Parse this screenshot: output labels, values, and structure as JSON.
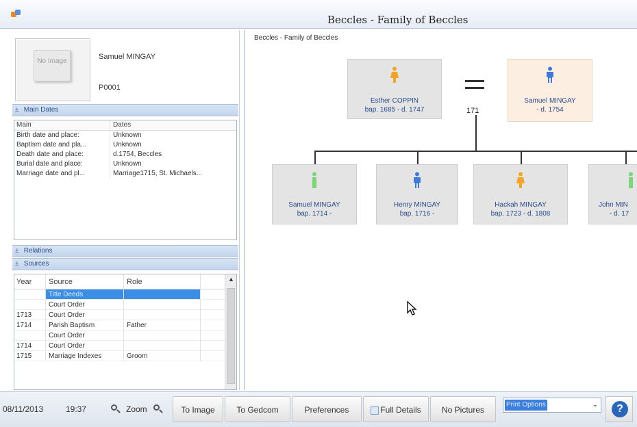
{
  "window": {
    "title": "Beccles - Family of Beccles"
  },
  "person": {
    "photo_text": "No Image",
    "name": "Samuel MINGAY",
    "id": "P0001"
  },
  "main_dates": {
    "header": "Main Dates",
    "expander": "±",
    "columns": [
      "Main",
      "Dates"
    ],
    "rows": [
      {
        "main": "Birth date and place:",
        "dates": "Unknown"
      },
      {
        "main": "Baptism date and pla...",
        "dates": "Unknown"
      },
      {
        "main": "Death date and place:",
        "dates": "d.1754, Beccles"
      },
      {
        "main": "Burial date and place:",
        "dates": "Unknown"
      },
      {
        "main": "Marriage date and pl...",
        "dates": "Marriage1715, St. Michaels..."
      }
    ]
  },
  "relations": {
    "header": "Relations",
    "expander": "±"
  },
  "sources": {
    "header": "Sources",
    "expander": "±",
    "columns": [
      "Year",
      "Source",
      "Role"
    ],
    "rows": [
      {
        "year": "",
        "source": "Title Deeds",
        "role": "",
        "selected": true
      },
      {
        "year": "",
        "source": "Court Order",
        "role": ""
      },
      {
        "year": "1713",
        "source": "Court Order",
        "role": ""
      },
      {
        "year": "1714",
        "source": "Parish Baptism",
        "role": "Father"
      },
      {
        "year": "",
        "source": "Court Order",
        "role": ""
      },
      {
        "year": "1714",
        "source": "Court Order",
        "role": ""
      },
      {
        "year": "1715",
        "source": "Marriage Indexes",
        "role": "Groom"
      }
    ]
  },
  "tree": {
    "caption": "Beccles - Family of Beccles",
    "marriage_year": "171",
    "parents": [
      {
        "name": "Esther COPPIN",
        "dates": "bap. 1685 - d. 1747",
        "gender": "female",
        "color": "#f2a623"
      },
      {
        "name": "Samuel MINGAY",
        "dates": "- d. 1754",
        "gender": "male",
        "color": "#3f7ad8"
      }
    ],
    "children": [
      {
        "name": "Samuel MINGAY",
        "dates": "bap. 1714 -",
        "gender": "unknown",
        "color": "#7fd47a"
      },
      {
        "name": "Henry MINGAY",
        "dates": "bap. 1716 -",
        "gender": "male",
        "color": "#3f7ad8"
      },
      {
        "name": "Hackah MINGAY",
        "dates": "bap. 1723 - d. 1808",
        "gender": "female",
        "color": "#f2a623"
      },
      {
        "name": "John MIN",
        "dates": "- d. 17",
        "gender": "unknown",
        "color": "#7fd47a"
      }
    ]
  },
  "toolbar": {
    "date": "08/11/2013",
    "time": "19:37",
    "zoom_label": "Zoom",
    "to_image": "To Image",
    "to_gedcom": "To Gedcom",
    "preferences": "Preferences",
    "full_details": "Full Details",
    "no_pictures": "No Pictures",
    "print_options": "Print Options",
    "help": "?"
  },
  "icons": [
    "app-icon",
    "zoom-out-icon",
    "zoom-in-icon",
    "female-figure-icon",
    "male-figure-icon",
    "unknown-figure-icon",
    "help-icon",
    "dropdown-arrow-icon",
    "scroll-up-icon",
    "mouse-cursor-icon",
    "checkbox-icon"
  ]
}
